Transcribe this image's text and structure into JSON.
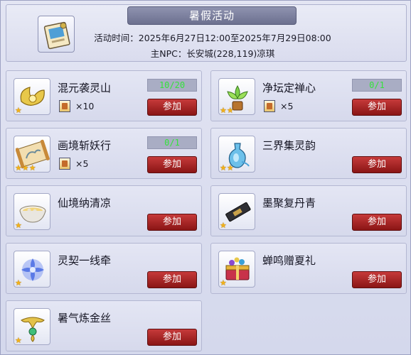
{
  "header": {
    "title": "暑假活动",
    "time_line": "活动时间：2025年6月27日12:00至2025年7月29日08:00",
    "npc_line": "主NPC：长安城(228,119)凉琪"
  },
  "join_label": "参加",
  "activities": [
    {
      "title": "混元袭灵山",
      "progress": "10/20",
      "reward_qty": "×10",
      "stars": "★"
    },
    {
      "title": "净坛定禅心",
      "progress": "0/1",
      "reward_qty": "×5",
      "stars": "★★"
    },
    {
      "title": "画境斩妖行",
      "progress": "0/1",
      "reward_qty": "×5",
      "stars": "★★★"
    },
    {
      "title": "三界集灵韵",
      "progress": "",
      "reward_qty": "",
      "stars": "★★"
    },
    {
      "title": "仙境纳清凉",
      "progress": "",
      "reward_qty": "",
      "stars": "★"
    },
    {
      "title": "墨聚复丹青",
      "progress": "",
      "reward_qty": "",
      "stars": "★"
    },
    {
      "title": "灵契一线牵",
      "progress": "",
      "reward_qty": "",
      "stars": "★"
    },
    {
      "title": "蝉鸣赠夏礼",
      "progress": "",
      "reward_qty": "",
      "stars": "★"
    },
    {
      "title": "暑气炼金丝",
      "progress": "",
      "reward_qty": "",
      "stars": "★"
    }
  ]
}
